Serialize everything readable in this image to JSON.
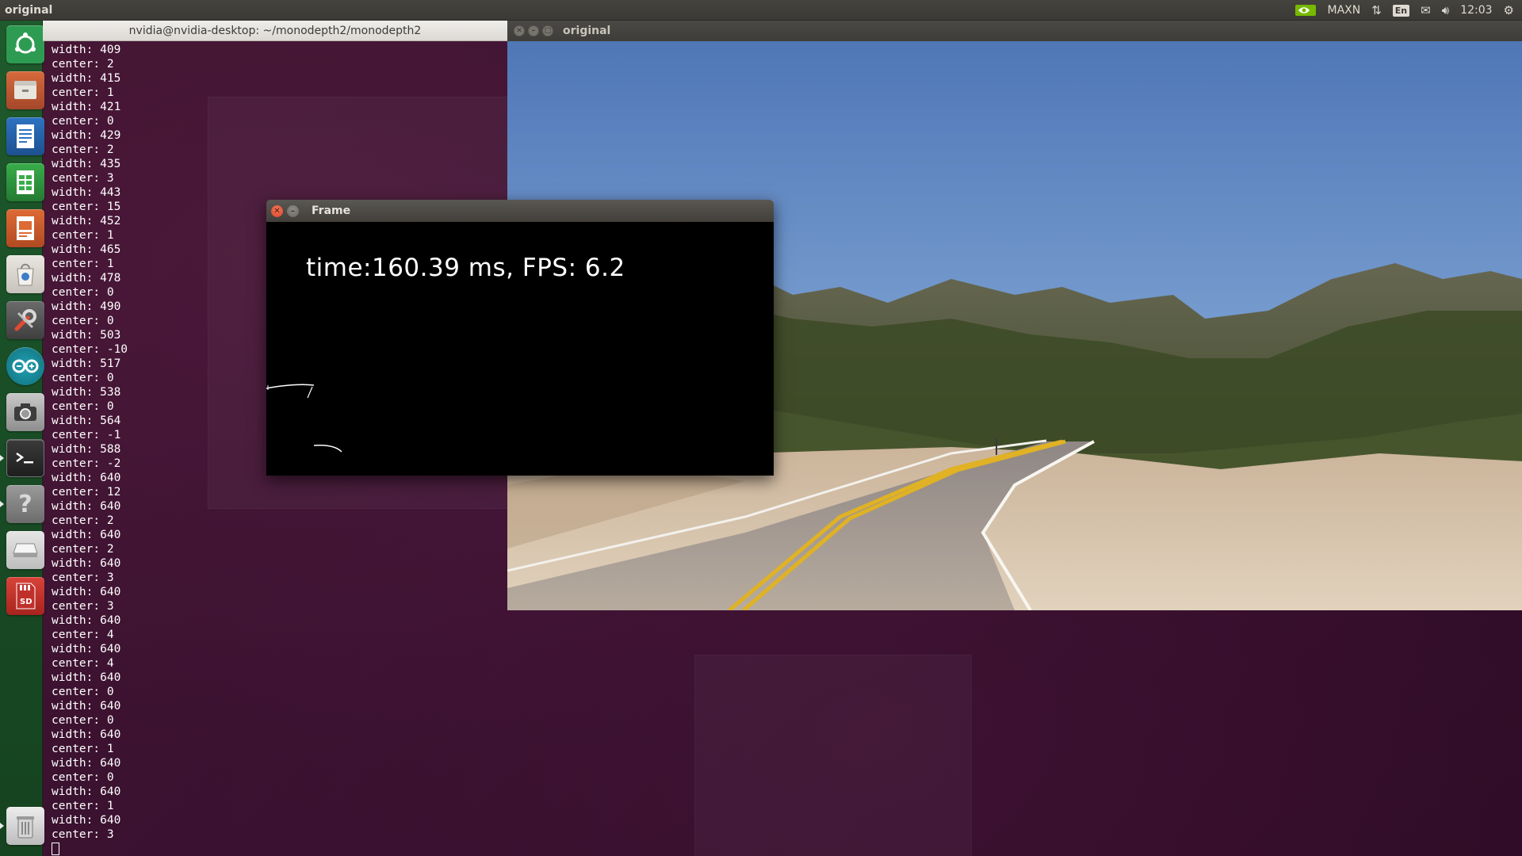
{
  "top_panel": {
    "app_title": "original",
    "power_mode": "MAXN",
    "language": "En",
    "clock": "12:03",
    "icons": [
      "nvidia-icon",
      "network-icon",
      "mail-icon",
      "volume-icon",
      "gear-icon"
    ]
  },
  "launcher": {
    "items": [
      {
        "name": "ubuntu-dash-icon",
        "color": "#2e8b4a"
      },
      {
        "name": "files-icon",
        "color": "#b5562f"
      },
      {
        "name": "writer-icon",
        "color": "#1f5fa8"
      },
      {
        "name": "calc-icon",
        "color": "#2f9a3c"
      },
      {
        "name": "impress-icon",
        "color": "#c9552a"
      },
      {
        "name": "software-center-icon",
        "color": "#d7d3cc"
      },
      {
        "name": "system-settings-icon",
        "color": "#5a5a5a"
      },
      {
        "name": "arduino-icon",
        "color": "#1c8a9a"
      },
      {
        "name": "camera-icon",
        "color": "#9a9a9a"
      },
      {
        "name": "terminal-icon",
        "color": "#2b2b2b"
      },
      {
        "name": "help-icon",
        "color": "#8a8a8a"
      },
      {
        "name": "drive-icon",
        "color": "#d6d6d6"
      },
      {
        "name": "sd-card-icon",
        "color": "#c8312b"
      },
      {
        "name": "trash-icon",
        "color": "#cfcfcf"
      }
    ]
  },
  "terminal": {
    "title": "nvidia@nvidia-desktop: ~/monodepth2/monodepth2",
    "lines": [
      "width: 409",
      "center: 2",
      "width: 415",
      "center: 1",
      "width: 421",
      "center: 0",
      "width: 429",
      "center: 2",
      "width: 435",
      "center: 3",
      "width: 443",
      "center: 15",
      "width: 452",
      "center: 1",
      "width: 465",
      "center: 1",
      "width: 478",
      "center: 0",
      "width: 490",
      "center: 0",
      "width: 503",
      "center: -10",
      "width: 517",
      "center: 0",
      "width: 538",
      "center: 0",
      "width: 564",
      "center: -1",
      "width: 588",
      "center: -2",
      "width: 640",
      "center: 12",
      "width: 640",
      "center: 2",
      "width: 640",
      "center: 2",
      "width: 640",
      "center: 3",
      "width: 640",
      "center: 3",
      "width: 640",
      "center: 4",
      "width: 640",
      "center: 4",
      "width: 640",
      "center: 0",
      "width: 640",
      "center: 0",
      "width: 640",
      "center: 1",
      "width: 640",
      "center: 0",
      "width: 640",
      "center: 1",
      "width: 640",
      "center: 3"
    ]
  },
  "original_window": {
    "title": "original"
  },
  "frame_window": {
    "title": "Frame",
    "overlay_text": "time:160.39 ms, FPS: 6.2"
  }
}
